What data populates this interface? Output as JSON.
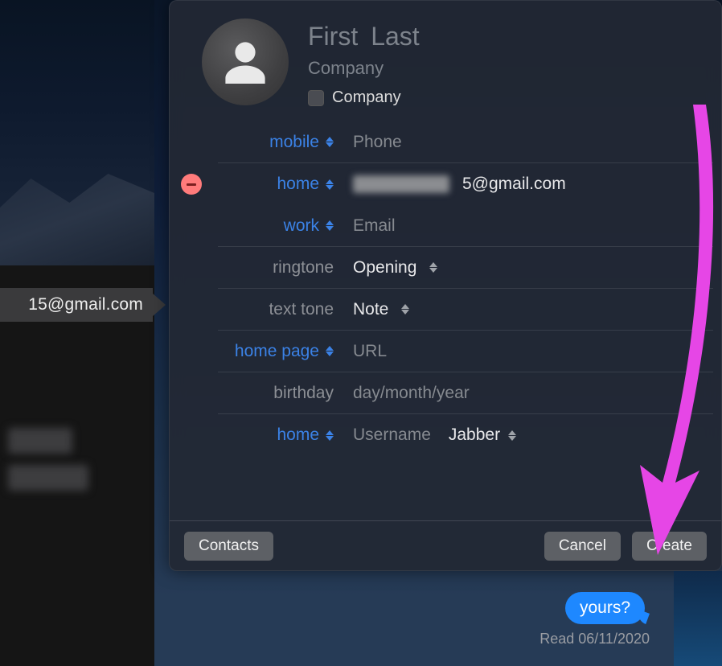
{
  "sidebar": {
    "selected_email": "15@gmail.com"
  },
  "contact": {
    "first_placeholder": "First",
    "last_placeholder": "Last",
    "company_placeholder": "Company",
    "company_checkbox_label": "Company"
  },
  "fields": {
    "mobile": {
      "label": "mobile",
      "placeholder": "Phone"
    },
    "home_email": {
      "label": "home",
      "value_suffix": "5@gmail.com"
    },
    "work_email": {
      "label": "work",
      "placeholder": "Email"
    },
    "ringtone": {
      "label": "ringtone",
      "value": "Opening"
    },
    "text_tone": {
      "label": "text tone",
      "value": "Note"
    },
    "home_page": {
      "label": "home page",
      "placeholder": "URL"
    },
    "birthday": {
      "label": "birthday",
      "placeholder": "day/month/year"
    },
    "im": {
      "label": "home",
      "placeholder": "Username",
      "service": "Jabber"
    }
  },
  "footer": {
    "contacts": "Contacts",
    "cancel": "Cancel",
    "create": "Create"
  },
  "chat": {
    "bubble": "yours?",
    "receipt": "Read 06/11/2020"
  }
}
